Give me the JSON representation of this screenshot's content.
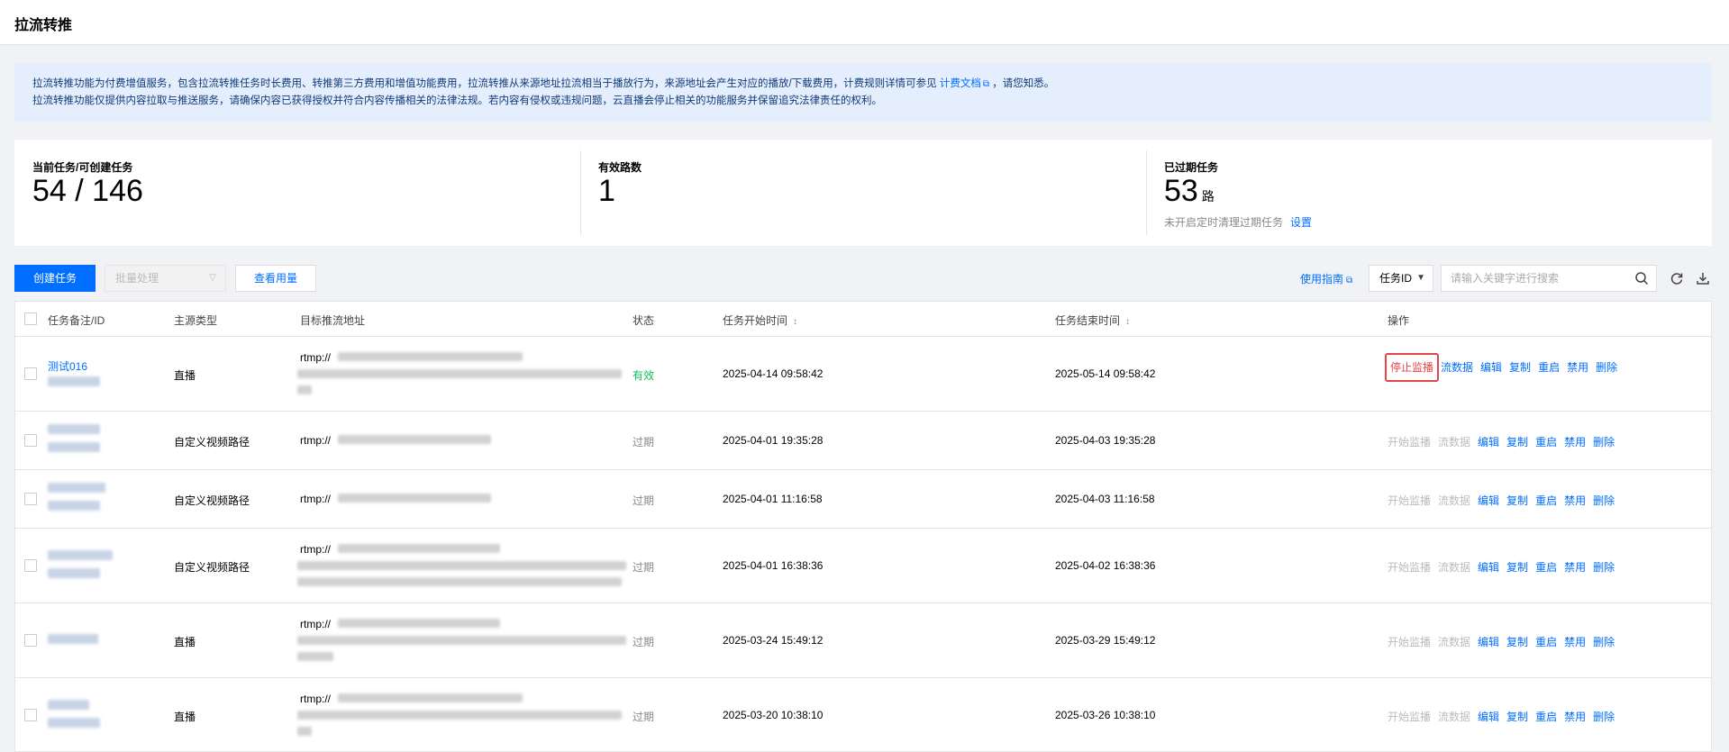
{
  "page": {
    "title": "拉流转推"
  },
  "notice": {
    "line1_prefix": "拉流转推功能为付费增值服务，包含拉流转推任务时长费用、转推第三方费用和增值功能费用，拉流转推从来源地址拉流相当于播放行为，来源地址会产生对应的播放/下载费用，计费规则详情可参见",
    "line1_link": "计费文档",
    "line1_suffix": "，请您知悉。",
    "line2": "拉流转推功能仅提供内容拉取与推送服务，请确保内容已获得授权并符合内容传播相关的法律法规。若内容有侵权或违规问题，云直播会停止相关的功能服务并保留追究法律责任的权利。"
  },
  "stats": {
    "current": {
      "label": "当前任务/可创建任务",
      "value": "54 / 146"
    },
    "valid": {
      "label": "有效路数",
      "value": "1"
    },
    "expired": {
      "label": "已过期任务",
      "value": "53",
      "unit": "路",
      "sub": "未开启定时清理过期任务",
      "sub_link": "设置"
    }
  },
  "toolbar": {
    "create": "创建任务",
    "batch": "批量处理",
    "usage": "查看用量",
    "guide": "使用指南",
    "id_select": "任务ID",
    "search_placeholder": "请输入关键字进行搜索"
  },
  "table": {
    "headers": {
      "name": "任务备注/ID",
      "source_type": "主源类型",
      "target": "目标推流地址",
      "status": "状态",
      "start": "任务开始时间",
      "end": "任务结束时间",
      "ops": "操作"
    },
    "op_labels": {
      "stop_monitor": "停止监播",
      "start_monitor": "开始监播",
      "stream_data": "流数据",
      "edit": "编辑",
      "copy": "复制",
      "restart": "重启",
      "disable": "禁用",
      "delete": "删除"
    },
    "rows": [
      {
        "name": "测试016",
        "source_type": "直播",
        "target_prefix": "rtmp://",
        "status": "有效",
        "start": "2025-04-14 09:58:42",
        "end": "2025-05-14 09:58:42"
      },
      {
        "name": "",
        "source_type": "自定义视频路径",
        "target_prefix": "rtmp://",
        "status": "过期",
        "start": "2025-04-01 19:35:28",
        "end": "2025-04-03 19:35:28"
      },
      {
        "name": "",
        "source_type": "自定义视频路径",
        "target_prefix": "rtmp://",
        "status": "过期",
        "start": "2025-04-01 11:16:58",
        "end": "2025-04-03 11:16:58"
      },
      {
        "name": "",
        "source_type": "自定义视频路径",
        "target_prefix": "rtmp://",
        "status": "过期",
        "start": "2025-04-01 16:38:36",
        "end": "2025-04-02 16:38:36"
      },
      {
        "name": "",
        "source_type": "直播",
        "target_prefix": "rtmp://",
        "status": "过期",
        "start": "2025-03-24 15:49:12",
        "end": "2025-03-29 15:49:12"
      },
      {
        "name": "",
        "source_type": "直播",
        "target_prefix": "rtmp://",
        "status": "过期",
        "start": "2025-03-20 10:38:10",
        "end": "2025-03-26 10:38:10"
      }
    ]
  }
}
